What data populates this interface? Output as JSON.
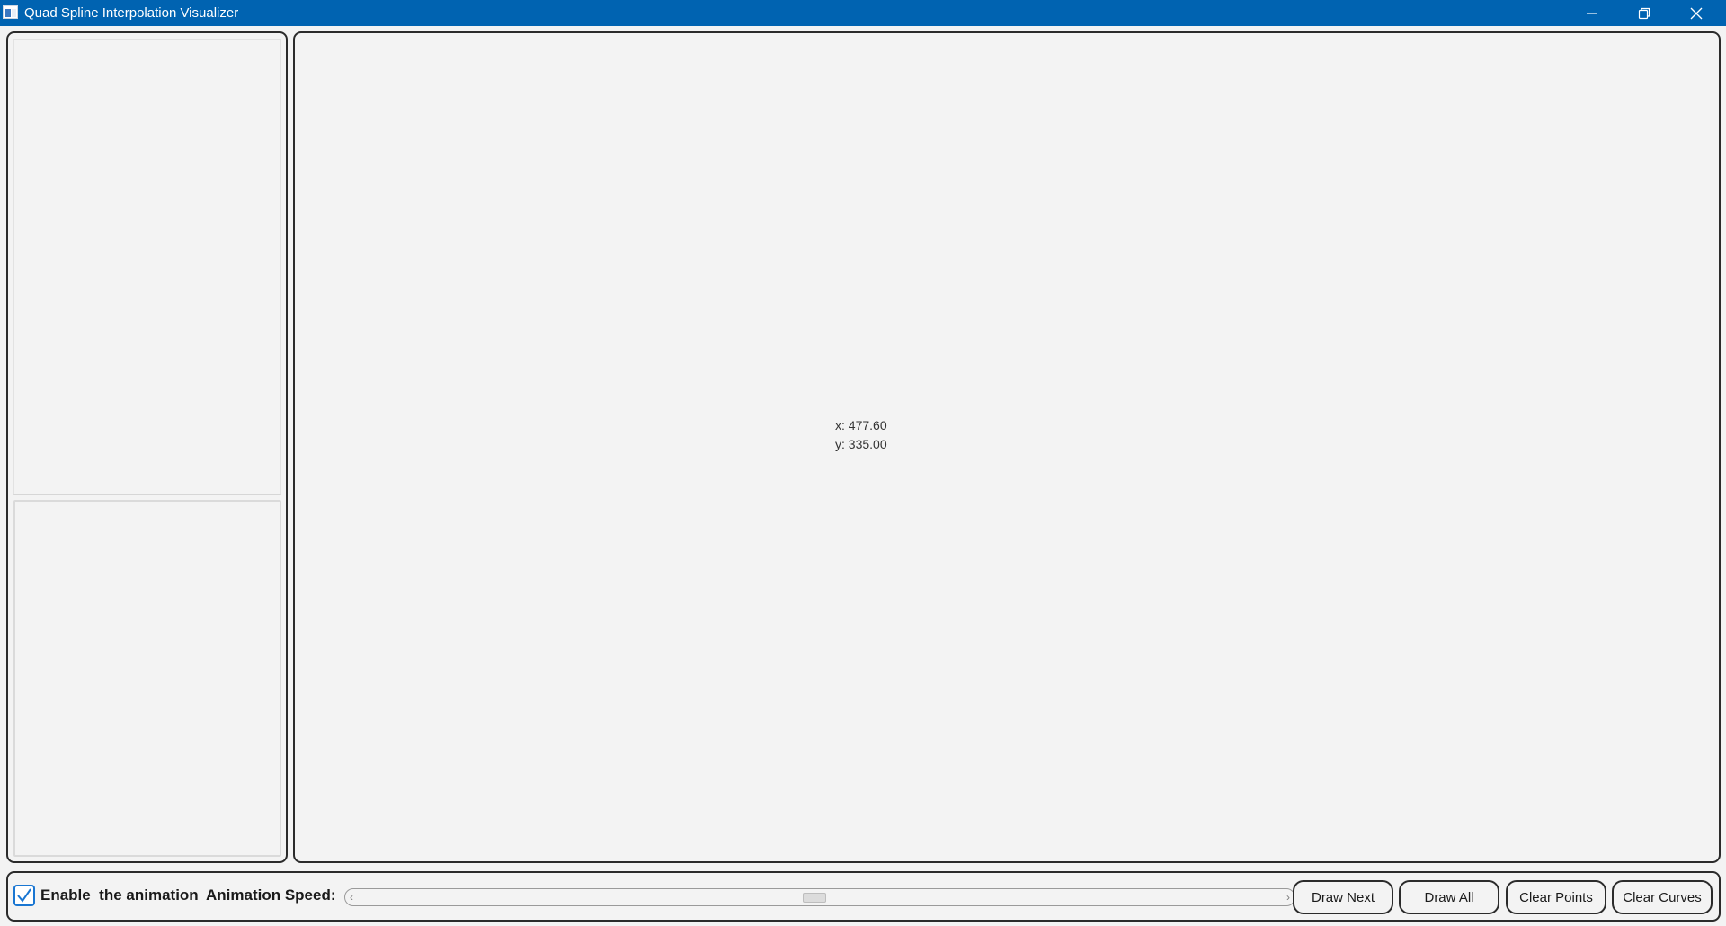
{
  "window": {
    "title": "Quad Spline Interpolation Visualizer",
    "controls": {
      "minimize_icon": "minimize-icon",
      "maximize_icon": "restore-icon",
      "close_icon": "close-icon"
    }
  },
  "canvas": {
    "coord_x": "x: 477.60",
    "coord_y": "y: 335.00"
  },
  "controls": {
    "animation_checkbox": {
      "label": "Enable  the animation",
      "checked": true
    },
    "speed_label": "Animation Speed:",
    "speed_slider": {
      "value_fraction": 0.5
    },
    "buttons": {
      "draw_next": "Draw Next",
      "draw_all": "Draw All",
      "clear_points": "Clear Points",
      "clear_curves": "Clear Curves"
    }
  },
  "colors": {
    "titlebar": "#0063b1",
    "background": "#f3f3f3",
    "checkbox_accent": "#1976d2"
  }
}
